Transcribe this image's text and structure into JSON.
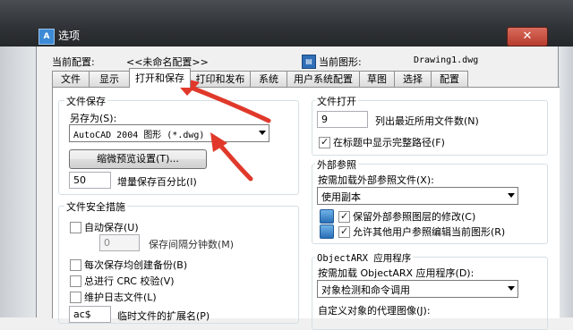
{
  "window": {
    "title": "选项",
    "close_glyph": "✕",
    "icon_text": "A"
  },
  "header": {
    "current_profile_label": "当前配置:",
    "current_profile_value": "<<未命名配置>>",
    "current_drawing_label": "当前图形:",
    "current_drawing_value": "Drawing1.dwg"
  },
  "tabs": [
    {
      "label": "文件"
    },
    {
      "label": "显示"
    },
    {
      "label": "打开和保存"
    },
    {
      "label": "打印和发布"
    },
    {
      "label": "系统"
    },
    {
      "label": "用户系统配置"
    },
    {
      "label": "草图"
    },
    {
      "label": "选择"
    },
    {
      "label": "配置"
    }
  ],
  "file_save": {
    "title": "文件保存",
    "save_as_label": "另存为(S):",
    "save_as_value": "AutoCAD 2004 图形 (*.dwg)",
    "thumbnail_button": "缩微预览设置(T)...",
    "incremental_value": "50",
    "incremental_label": "增量保存百分比(I)"
  },
  "file_safety": {
    "title": "文件安全措施",
    "autosave_label": "自动保存(U)",
    "interval_value": "0",
    "interval_label": "保存间隔分钟数(M)",
    "backup_label": "每次保存均创建备份(B)",
    "crc_label": "总进行 CRC 校验(V)",
    "log_label": "维护日志文件(L)",
    "temp_ext_value": "ac$",
    "temp_ext_label": "临时文件的扩展名(P)"
  },
  "file_open": {
    "title": "文件打开",
    "recent_count_value": "9",
    "recent_count_label": "列出最近所用文件数(N)",
    "show_full_path_label": "在标题中显示完整路径(F)"
  },
  "xref": {
    "title": "外部参照",
    "demand_load_label": "按需加载外部参照文件(X):",
    "demand_load_value": "使用副本",
    "retain_changes_label": "保留外部参照图层的修改(C)",
    "allow_edit_label": "允许其他用户参照编辑当前图形(R)"
  },
  "objectarx": {
    "title": "ObjectARX 应用程序",
    "demand_load_label": "按需加载 ObjectARX 应用程序(D):",
    "demand_load_value": "对象检测和命令调用",
    "proxy_label": "自定义对象的代理图像(J):"
  },
  "colors": {
    "annotation_arrow": "#e0392b",
    "title_bar": "#2f3236"
  }
}
